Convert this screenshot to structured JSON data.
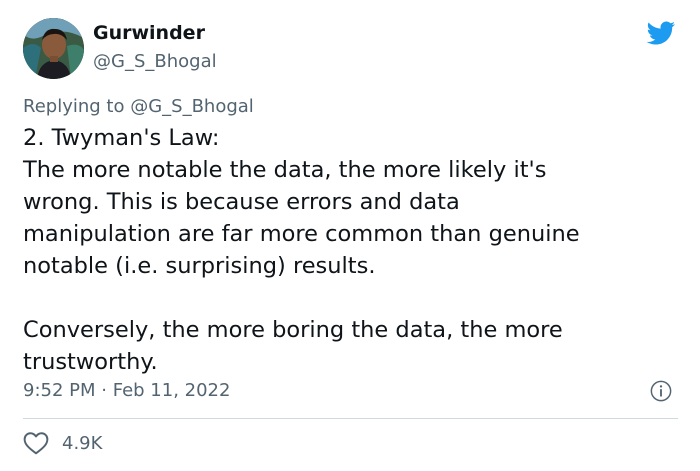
{
  "author": {
    "name": "Gurwinder",
    "handle": "@G_S_Bhogal"
  },
  "reply": {
    "prefix": "Replying to ",
    "mention": "@G_S_Bhogal"
  },
  "tweet": {
    "lines": [
      "2. Twyman's Law:",
      "The more notable the data, the more likely it's",
      "wrong. This is because errors and data",
      "manipulation are far more common than genuine",
      "notable (i.e. surprising) results.",
      "",
      "Conversely, the more boring the data, the more",
      "trustworthy."
    ]
  },
  "meta": {
    "time": "9:52 PM",
    "separator": " · ",
    "date": "Feb 11, 2022"
  },
  "engagement": {
    "likes": "4.9K"
  },
  "icons": {
    "brand": "twitter-bird-icon",
    "info": "info-icon",
    "like": "heart-icon"
  },
  "colors": {
    "brand": "#1d9bf0",
    "text": "#0f1419",
    "secondary": "#536471",
    "divider": "#cfd9de"
  }
}
